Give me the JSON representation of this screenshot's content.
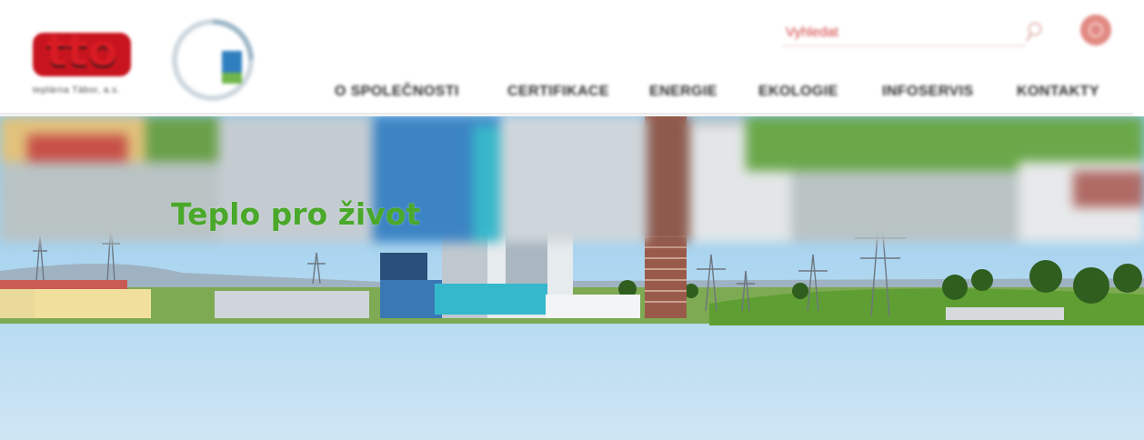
{
  "brand": {
    "logo_text": "tto",
    "logo_subtitle": "teplárna Tábor, a.s."
  },
  "search": {
    "placeholder": "Vyhledat"
  },
  "nav": {
    "items": [
      {
        "label": "O SPOLEČNOSTI"
      },
      {
        "label": "CERTIFIKACE"
      },
      {
        "label": "ENERGIE"
      },
      {
        "label": "EKOLOGIE"
      },
      {
        "label": "INFOSERVIS"
      },
      {
        "label": "KONTAKTY"
      }
    ]
  },
  "hero": {
    "slogan": "Teplo pro život"
  },
  "colors": {
    "brand_red": "#c8141e",
    "slogan_green": "#4aa82a",
    "sky": "#9fd0ee",
    "nav_text": "#2e2e2e"
  },
  "icons": [
    "search-icon",
    "user-icon",
    "certificate-logo"
  ]
}
